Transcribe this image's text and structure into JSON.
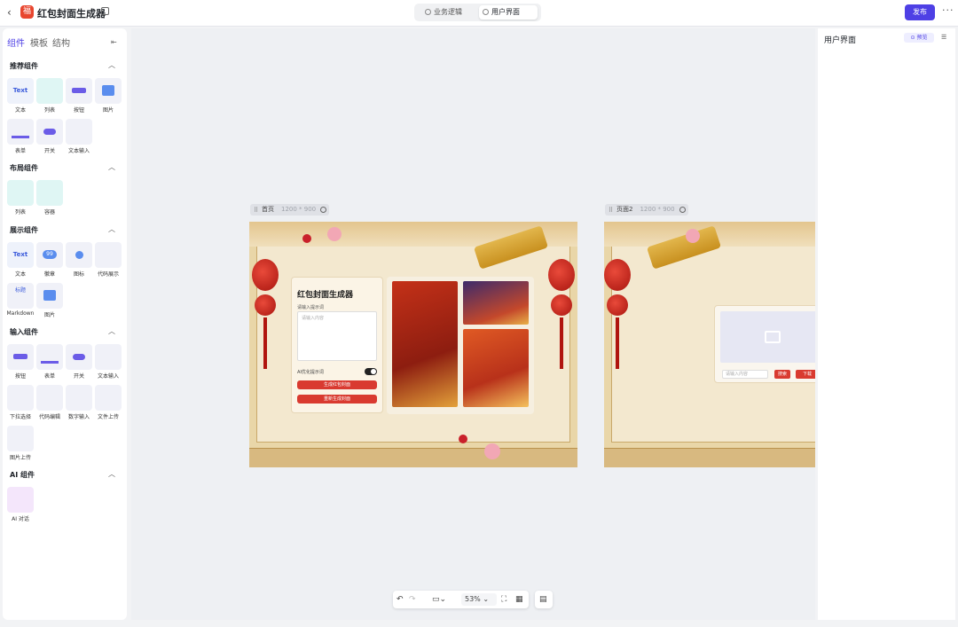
{
  "app": {
    "title": "红包封面生成器",
    "publish_label": "发布"
  },
  "mode_switch": [
    {
      "label": "业务逻辑"
    },
    {
      "label": "用户界面"
    }
  ],
  "left_panel": {
    "tabs": [
      {
        "label": "组件"
      },
      {
        "label": "模板"
      },
      {
        "label": "结构"
      }
    ],
    "sections": [
      {
        "title": "推荐组件",
        "items": [
          {
            "label": "文本",
            "preview": "Text"
          },
          {
            "label": "列表"
          },
          {
            "label": "按钮"
          },
          {
            "label": "图片"
          },
          {
            "label": "表单"
          },
          {
            "label": "开关"
          },
          {
            "label": "文本输入"
          }
        ]
      },
      {
        "title": "布局组件",
        "items": [
          {
            "label": "列表"
          },
          {
            "label": "容器"
          }
        ]
      },
      {
        "title": "展示组件",
        "items": [
          {
            "label": "文本",
            "preview": "Text"
          },
          {
            "label": "徽章",
            "preview": "99"
          },
          {
            "label": "图标"
          },
          {
            "label": "代码展示"
          },
          {
            "label": "Markdown",
            "preview": "标题"
          },
          {
            "label": "图片"
          }
        ]
      },
      {
        "title": "输入组件",
        "items": [
          {
            "label": "按钮"
          },
          {
            "label": "表单"
          },
          {
            "label": "开关"
          },
          {
            "label": "文本输入"
          },
          {
            "label": "下拉选择"
          },
          {
            "label": "代码编辑"
          },
          {
            "label": "数字输入"
          },
          {
            "label": "文件上传"
          },
          {
            "label": "图片上传"
          }
        ]
      },
      {
        "title": "AI 组件",
        "items": [
          {
            "label": "AI 对话"
          }
        ]
      }
    ]
  },
  "canvas": {
    "pages": [
      {
        "name": "首页",
        "size": "1200 * 900"
      },
      {
        "name": "页面2",
        "size": "1200 * 900"
      }
    ],
    "card": {
      "title": "红包封面生成器",
      "input_label": "请输入提示词",
      "input_placeholder": "请输入内容",
      "toggle_label": "AI优化提示词",
      "btn_generate": "生成红包封面",
      "btn_reset": "重新生成封面"
    },
    "page2": {
      "input_placeholder": "请输入内容",
      "btn_search": "搜索",
      "btn_download": "下载"
    },
    "zoom": "53%"
  },
  "right_panel": {
    "title": "用户界面",
    "preview_label": "预览"
  }
}
